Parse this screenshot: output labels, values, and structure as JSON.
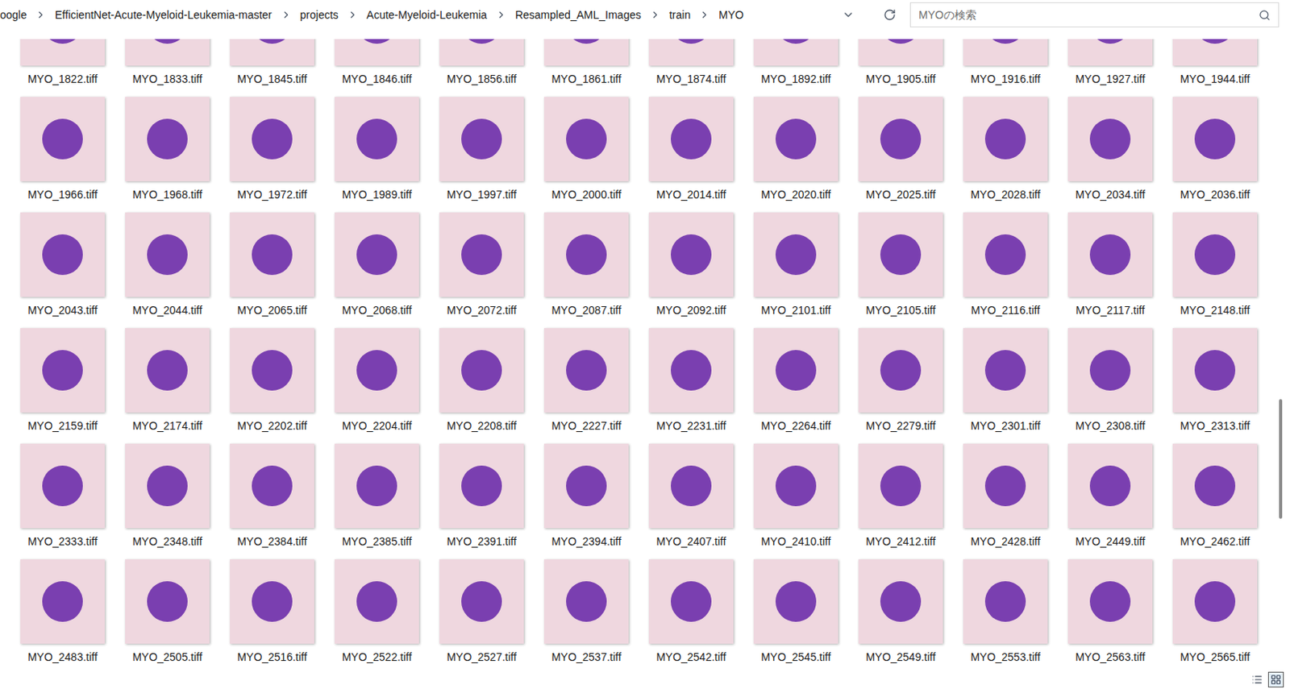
{
  "breadcrumb": [
    "oogle",
    "EfficientNet-Acute-Myeloid-Leukemia-master",
    "projects",
    "Acute-Myeloid-Leukemia",
    "Resampled_AML_Images",
    "train",
    "MYO"
  ],
  "search": {
    "placeholder": "MYOの検索"
  },
  "files": [
    "MYO_1822.tiff",
    "MYO_1833.tiff",
    "MYO_1845.tiff",
    "MYO_1846.tiff",
    "MYO_1856.tiff",
    "MYO_1861.tiff",
    "MYO_1874.tiff",
    "MYO_1892.tiff",
    "MYO_1905.tiff",
    "MYO_1916.tiff",
    "MYO_1927.tiff",
    "MYO_1944.tiff",
    "MYO_1966.tiff",
    "MYO_1968.tiff",
    "MYO_1972.tiff",
    "MYO_1989.tiff",
    "MYO_1997.tiff",
    "MYO_2000.tiff",
    "MYO_2014.tiff",
    "MYO_2020.tiff",
    "MYO_2025.tiff",
    "MYO_2028.tiff",
    "MYO_2034.tiff",
    "MYO_2036.tiff",
    "MYO_2043.tiff",
    "MYO_2044.tiff",
    "MYO_2065.tiff",
    "MYO_2068.tiff",
    "MYO_2072.tiff",
    "MYO_2087.tiff",
    "MYO_2092.tiff",
    "MYO_2101.tiff",
    "MYO_2105.tiff",
    "MYO_2116.tiff",
    "MYO_2117.tiff",
    "MYO_2148.tiff",
    "MYO_2159.tiff",
    "MYO_2174.tiff",
    "MYO_2202.tiff",
    "MYO_2204.tiff",
    "MYO_2208.tiff",
    "MYO_2227.tiff",
    "MYO_2231.tiff",
    "MYO_2264.tiff",
    "MYO_2279.tiff",
    "MYO_2301.tiff",
    "MYO_2308.tiff",
    "MYO_2313.tiff",
    "MYO_2333.tiff",
    "MYO_2348.tiff",
    "MYO_2384.tiff",
    "MYO_2385.tiff",
    "MYO_2391.tiff",
    "MYO_2394.tiff",
    "MYO_2407.tiff",
    "MYO_2410.tiff",
    "MYO_2412.tiff",
    "MYO_2428.tiff",
    "MYO_2449.tiff",
    "MYO_2462.tiff",
    "MYO_2483.tiff",
    "MYO_2505.tiff",
    "MYO_2516.tiff",
    "MYO_2522.tiff",
    "MYO_2527.tiff",
    "MYO_2537.tiff",
    "MYO_2542.tiff",
    "MYO_2545.tiff",
    "MYO_2549.tiff",
    "MYO_2553.tiff",
    "MYO_2563.tiff",
    "MYO_2565.tiff"
  ],
  "scrollbar": {
    "position": 0.57,
    "size": 0.19
  },
  "view_buttons": [
    {
      "kind": "details",
      "selected": false
    },
    {
      "kind": "large-icons",
      "selected": true
    }
  ]
}
